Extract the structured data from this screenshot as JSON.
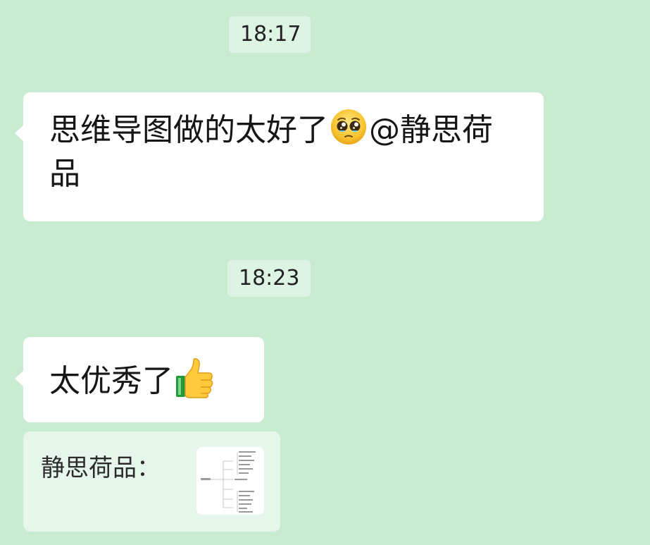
{
  "timestamps": [
    "18:17",
    "18:23"
  ],
  "messages": [
    {
      "text_before": "思维导图做的太好了",
      "emoji": "pleading-face-icon",
      "text_after": "@静思荷品"
    },
    {
      "text_before": "太优秀了",
      "emoji": "thumbs-up-icon"
    }
  ],
  "quote": {
    "sender_label": "静思荷品："
  },
  "colors": {
    "background": "#c9ebd2",
    "timestamp_bg": "#ddf3e3",
    "bubble_bg": "#ffffff",
    "quote_bg": "#e7f6eb"
  }
}
